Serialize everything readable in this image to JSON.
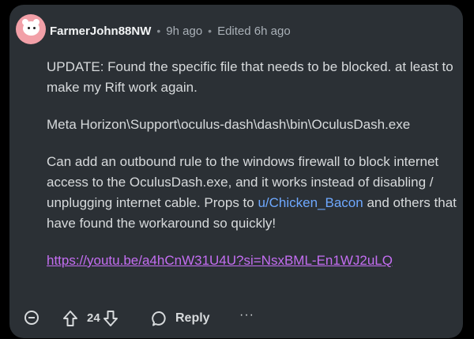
{
  "comment": {
    "author": "FarmerJohn88NW",
    "separator": "•",
    "posted": "9h ago",
    "edited": "Edited 6h ago",
    "paragraphs": [
      "UPDATE: Found the specific file that needs to be blocked. at least to make my Rift work again.",
      "Meta Horizon\\Support\\oculus-dash\\dash\\bin\\OculusDash.exe"
    ],
    "p3_before": "Can add an outbound rule to the windows firewall to block internet access to the OculusDash.exe, and it works instead of disabling / unplugging internet cable. Props to ",
    "p3_mention": "u/Chicken_Bacon",
    "p3_after": " and others that have found the workaround so quickly!",
    "link": "https://youtu.be/a4hCnW31U4U?si=NsxBML-En1WJ2uLQ"
  },
  "actions": {
    "score": "24",
    "reply_label": "Reply",
    "more_label": "···"
  },
  "icons": {
    "collapse": "minus-circle-icon",
    "upvote": "arrow-up-icon",
    "downvote": "arrow-down-icon",
    "reply": "speech-bubble-icon",
    "more": "ellipsis-icon",
    "avatar": "snoo-avatar-icon"
  },
  "colors": {
    "card_bg": "#2b3035",
    "text": "#d7dadc",
    "mention": "#6ea8ff",
    "link": "#c46ef2",
    "avatar_bg": "#f2a0a8"
  }
}
